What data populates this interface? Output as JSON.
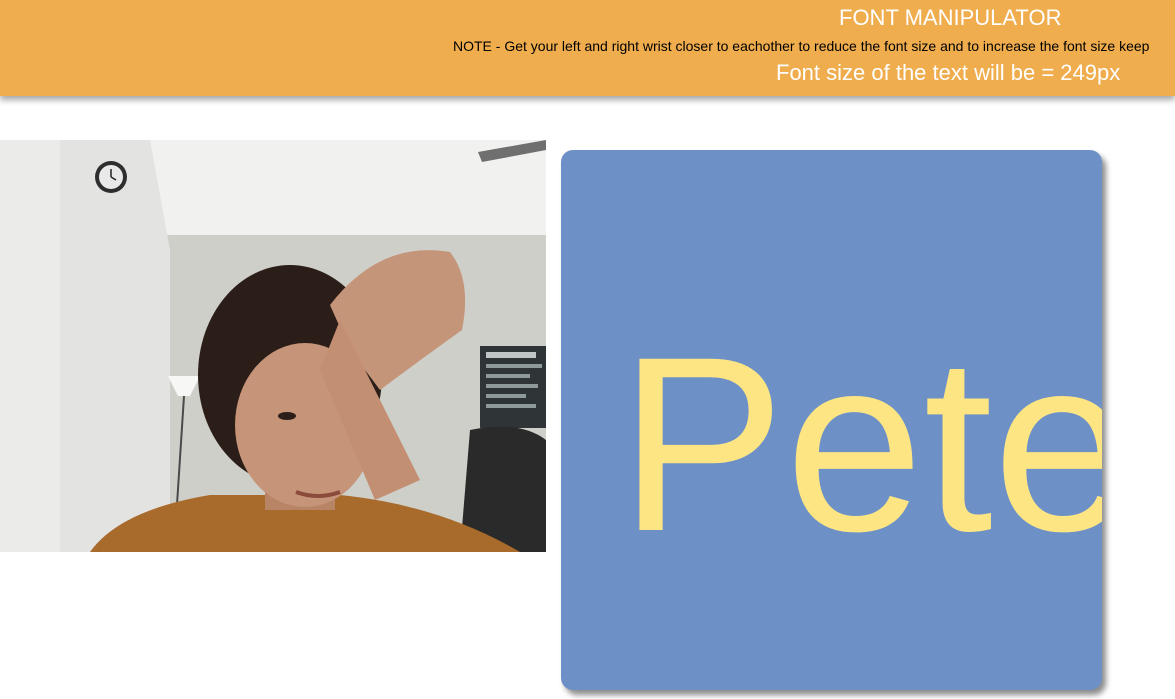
{
  "header": {
    "title": "FONT MANIPULATOR",
    "note": "NOTE - Get your left and right wrist closer to eachother to reduce the font size and to increase the font size keep",
    "font_size_label": "Font size of the text will be = 249px"
  },
  "preview": {
    "text": "Pete"
  },
  "colors": {
    "header_bg": "#efad4e",
    "text_box_bg": "#6d91c6",
    "text_color": "#fde584"
  }
}
